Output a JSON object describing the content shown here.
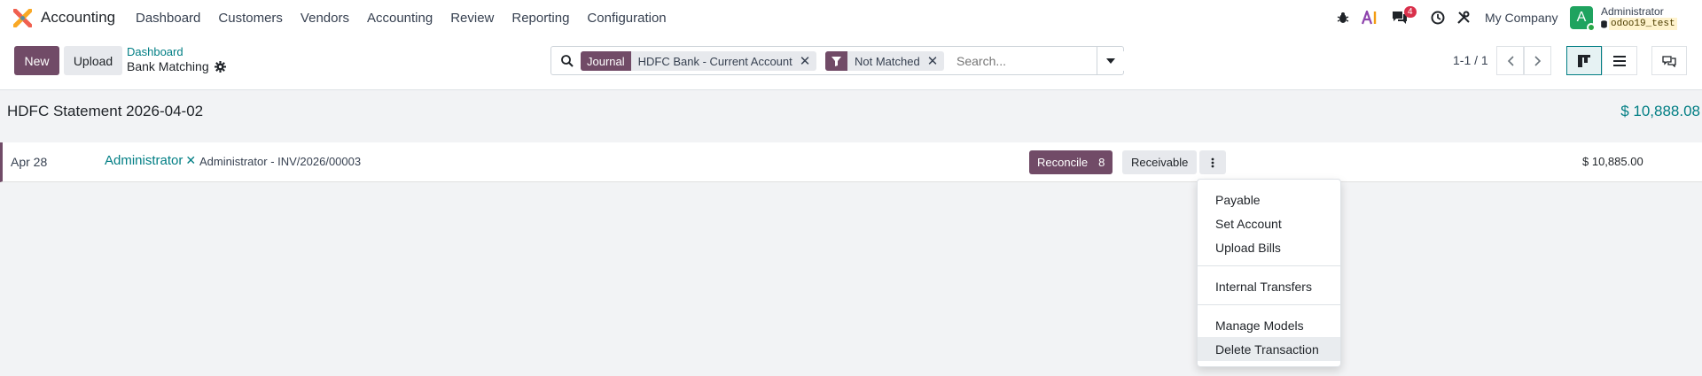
{
  "navbar": {
    "app_name": "Accounting",
    "menu": [
      "Dashboard",
      "Customers",
      "Vendors",
      "Accounting",
      "Review",
      "Reporting",
      "Configuration"
    ],
    "messages_count": "4",
    "company": "My Company",
    "user_initial": "A",
    "user_name": "Administrator",
    "db_name": "odoo19_test"
  },
  "control": {
    "new_label": "New",
    "upload_label": "Upload",
    "breadcrumb_parent": "Dashboard",
    "breadcrumb_current": "Bank Matching",
    "facets": [
      {
        "label": "Journal",
        "value": "HDFC Bank - Current Account"
      },
      {
        "label": "filter-icon",
        "value": "Not Matched"
      }
    ],
    "search_placeholder": "Search...",
    "pager": "1-1 / 1"
  },
  "statement": {
    "title": "HDFC Statement 2026-04-02",
    "balance": "$ 10,888.08"
  },
  "transaction": {
    "date": "Apr 28",
    "partner": "Administrator",
    "reference": "Administrator - INV/2026/00003",
    "reconcile_label": "Reconcile",
    "reconcile_count": "8",
    "receivable_label": "Receivable",
    "amount": "$ 10,885.00"
  },
  "dropdown": {
    "items": [
      "Payable",
      "Set Account",
      "Upload Bills",
      "Internal Transfers",
      "Manage Models",
      "Delete Transaction"
    ]
  },
  "colors": {
    "brand": "#714b67",
    "link": "#017e84"
  }
}
